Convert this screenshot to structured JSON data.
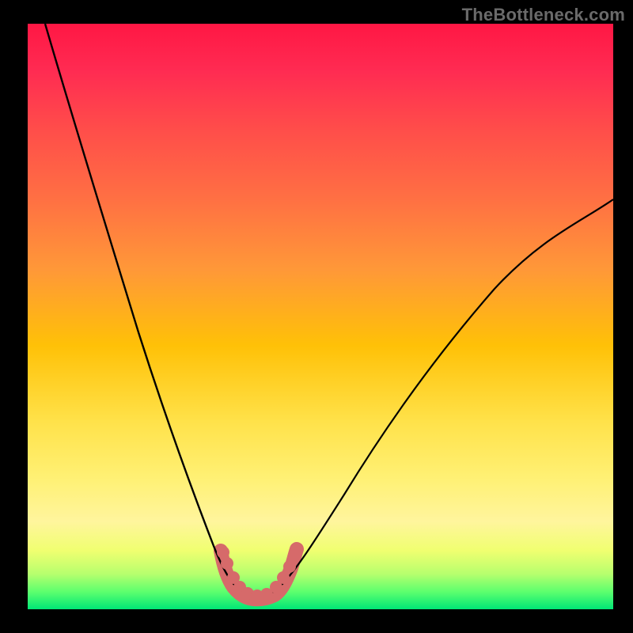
{
  "watermark": "TheBottleneck.com",
  "chart_data": {
    "type": "line",
    "title": "",
    "xlabel": "",
    "ylabel": "",
    "xlim": [
      0,
      100
    ],
    "ylim": [
      0,
      100
    ],
    "series": [
      {
        "name": "left-curve",
        "x": [
          3,
          6,
          9,
          12,
          15,
          18,
          21,
          24,
          27,
          30,
          33,
          34.5,
          35.5,
          36.5,
          38
        ],
        "y": [
          100,
          91,
          82,
          73,
          64,
          55,
          46,
          37,
          28,
          19,
          10,
          6.5,
          4.5,
          3.2,
          2.4
        ]
      },
      {
        "name": "right-curve",
        "x": [
          42,
          44,
          47,
          50,
          55,
          62,
          70,
          80,
          90,
          100
        ],
        "y": [
          2.4,
          4.5,
          8.5,
          13,
          20,
          30,
          40,
          51,
          61,
          70
        ]
      },
      {
        "name": "valley-band",
        "x": [
          33,
          34,
          35,
          36,
          37,
          38,
          39,
          40,
          41,
          42,
          43,
          44,
          45
        ],
        "y": [
          10,
          7.5,
          5.5,
          3.8,
          2.8,
          2.3,
          2.2,
          2.2,
          2.4,
          3.0,
          4.5,
          6.5,
          9
        ]
      }
    ],
    "colors": {
      "gradient_top": "#ff1744",
      "gradient_mid": "#ffc107",
      "gradient_bottom": "#00e676",
      "valley_band": "#d66a6a",
      "curve": "#000000",
      "frame": "#000000"
    }
  }
}
